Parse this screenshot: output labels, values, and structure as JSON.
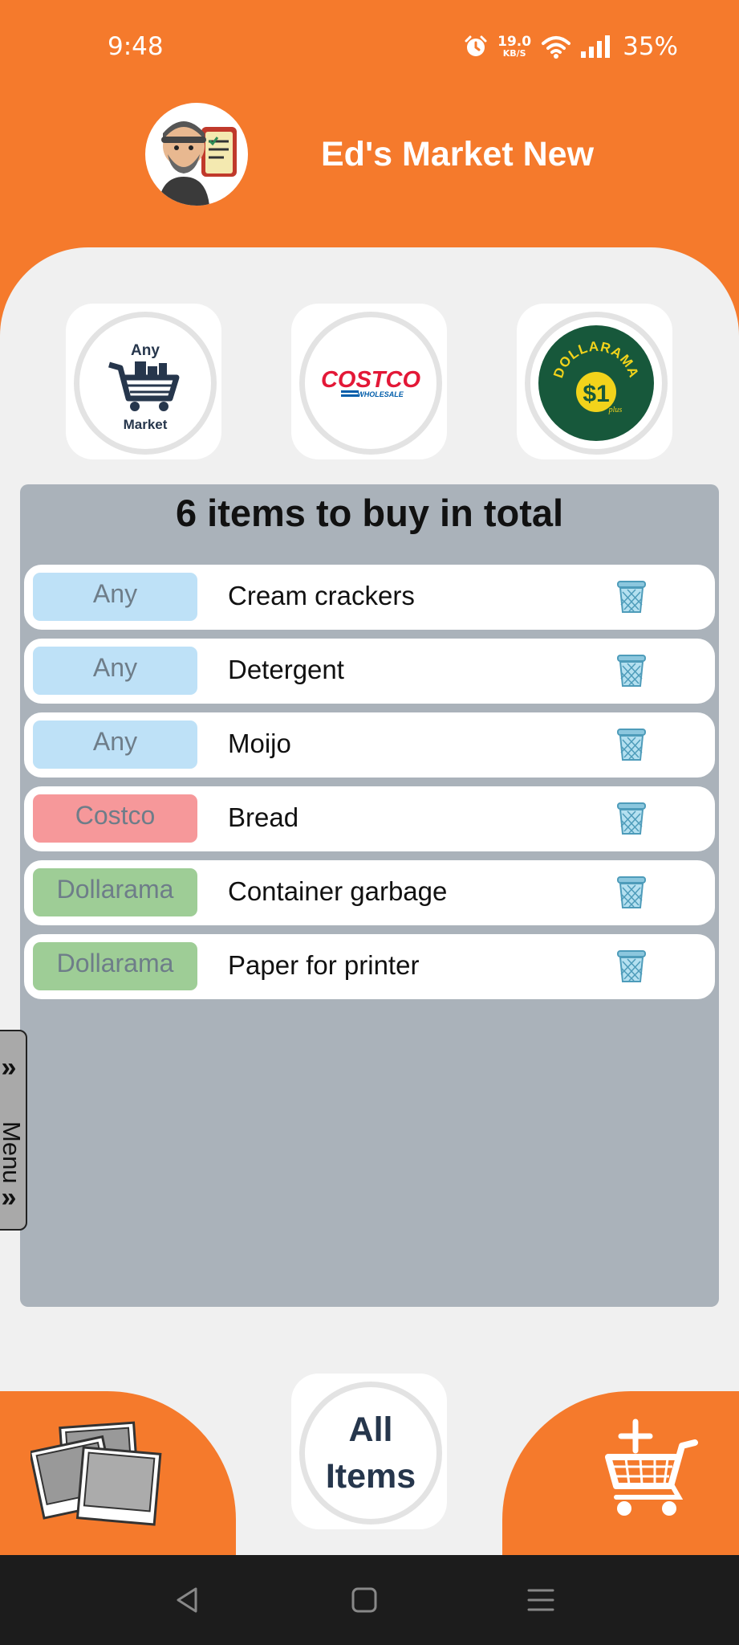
{
  "status_bar": {
    "time": "9:48",
    "net_speed_value": "19.0",
    "net_speed_unit": "KB/S",
    "battery": "35%"
  },
  "header": {
    "title": "Ed's Market New"
  },
  "stores": [
    {
      "name": "Any Market",
      "line1": "Any",
      "line2": "Market"
    },
    {
      "name": "Costco",
      "logo_main": "COSTCO",
      "logo_sub": "WHOLESALE"
    },
    {
      "name": "Dollarama",
      "logo_main": "DOLLARAMA",
      "logo_price": "$1",
      "logo_plus": "plus"
    }
  ],
  "list": {
    "count": "6",
    "count_text": "items to buy in total",
    "items": [
      {
        "store": "Any",
        "name": "Cream crackers"
      },
      {
        "store": "Any",
        "name": "Detergent"
      },
      {
        "store": "Any",
        "name": "Moijo"
      },
      {
        "store": "Costco",
        "name": "Bread"
      },
      {
        "store": "Dollarama",
        "name": "Container garbage"
      },
      {
        "store": "Dollarama",
        "name": "Paper for printer"
      }
    ]
  },
  "menu_tab": {
    "chevron": "»",
    "label": "Menu"
  },
  "bottom": {
    "all_items_line1": "All",
    "all_items_line2": "Items"
  },
  "colors": {
    "brand_orange": "#F57A2C",
    "tag_any": "#BEE1F7",
    "tag_costco": "#F6989A",
    "tag_dollarama": "#9ECD96"
  }
}
